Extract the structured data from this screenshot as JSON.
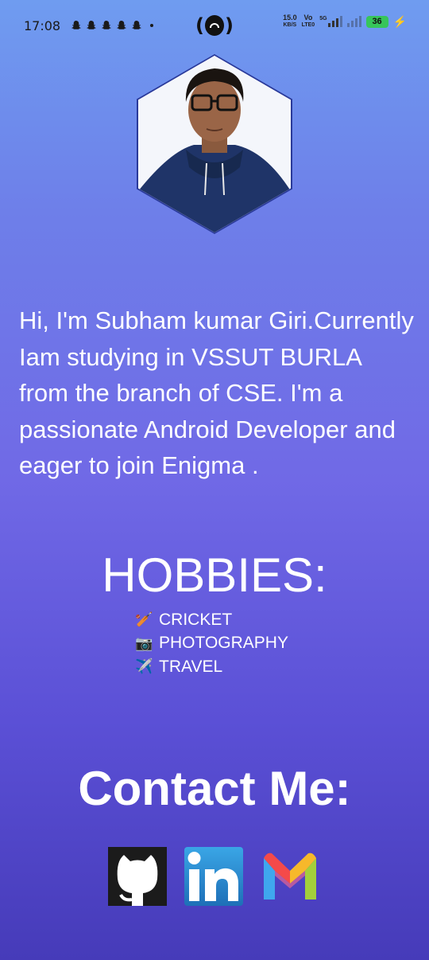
{
  "status_bar": {
    "time": "17:08",
    "speed_value": "15.0",
    "speed_unit": "KB/S",
    "volte_top": "Vo",
    "volte_bottom": "LTE0",
    "network": "5G",
    "battery": "36"
  },
  "profile": {
    "intro": "Hi, I'm Subham kumar Giri.Currently Iam studying in VSSUT BURLA from the branch of CSE. I'm a passionate Android Developer and eager to join Enigma ."
  },
  "hobbies": {
    "title": "HOBBIES:",
    "items": [
      {
        "emoji": "🏏",
        "label": "CRICKET"
      },
      {
        "emoji": "📷",
        "label": "PHOTOGRAPHY"
      },
      {
        "emoji": "✈️",
        "label": "TRAVEL"
      }
    ]
  },
  "contact": {
    "title": "Contact Me:",
    "links": [
      "github-icon",
      "linkedin-icon",
      "gmail-icon"
    ]
  },
  "colors": {
    "gradient_top": "#6f9cf0",
    "gradient_bottom": "#463bb9",
    "text": "#ffffff",
    "hex_border": "#2a3a9a"
  }
}
